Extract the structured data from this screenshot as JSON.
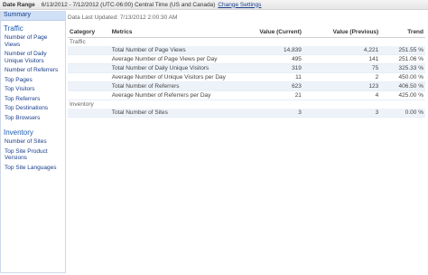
{
  "header": {
    "date_range_label": "Date Range",
    "date_range_value": "6/13/2012 - 7/12/2012 (UTC-06:00) Central Time (US and Canada)",
    "change_settings": "Change Settings"
  },
  "sidebar": {
    "summary": "Summary",
    "sections": [
      {
        "title": "Traffic",
        "items": [
          "Number of Page Views",
          "Number of Daily Unique Visitors",
          "Number of Referrers",
          "Top Pages",
          "Top Visitors",
          "Top Referrers",
          "Top Destinations",
          "Top Browsers"
        ]
      },
      {
        "title": "Inventory",
        "items": [
          "Number of Sites",
          "Top Site Product Versions",
          "Top Site Languages"
        ]
      }
    ]
  },
  "main": {
    "last_updated": "Data Last Updated: 7/13/2012 2:00:30 AM",
    "columns": [
      "Category",
      "Metrics",
      "Value (Current)",
      "Value (Previous)",
      "Trend"
    ],
    "groups": [
      {
        "name": "Traffic",
        "rows": [
          {
            "metric": "Total Number of Page Views",
            "current": "14,839",
            "previous": "4,221",
            "trend": "251.55 %"
          },
          {
            "metric": "Average Number of Page Views per Day",
            "current": "495",
            "previous": "141",
            "trend": "251.06 %"
          },
          {
            "metric": "Total Number of Daily Unique Visitors",
            "current": "319",
            "previous": "75",
            "trend": "325.33 %"
          },
          {
            "metric": "Average Number of Unique Visitors per Day",
            "current": "11",
            "previous": "2",
            "trend": "450.00 %"
          },
          {
            "metric": "Total Number of Referrers",
            "current": "623",
            "previous": "123",
            "trend": "406.50 %"
          },
          {
            "metric": "Average Number of Referrers per Day",
            "current": "21",
            "previous": "4",
            "trend": "425.00 %"
          }
        ]
      },
      {
        "name": "Inventory",
        "rows": [
          {
            "metric": "Total Number of Sites",
            "current": "3",
            "previous": "3",
            "trend": "0.00 %"
          }
        ]
      }
    ]
  },
  "colors": {
    "link": "#1a3e8c",
    "section_title": "#1a5cb3",
    "summary_bg": "#cfe0f7",
    "row_alt_bg": "#eef3fa"
  }
}
